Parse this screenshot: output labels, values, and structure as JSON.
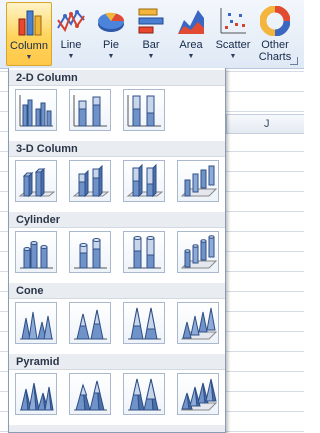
{
  "ribbon": {
    "buttons": [
      {
        "label": "Column",
        "arrow": "▼",
        "icon": "column-chart-icon"
      },
      {
        "label": "Line",
        "arrow": "▼",
        "icon": "line-chart-icon"
      },
      {
        "label": "Pie",
        "arrow": "▼",
        "icon": "pie-chart-icon"
      },
      {
        "label": "Bar",
        "arrow": "▼",
        "icon": "bar-chart-icon"
      },
      {
        "label": "Area",
        "arrow": "▼",
        "icon": "area-chart-icon"
      },
      {
        "label": "Scatter",
        "arrow": "▼",
        "icon": "scatter-chart-icon"
      },
      {
        "label1": "Other",
        "label2": "Charts",
        "arrow": "▼",
        "icon": "doughnut-chart-icon"
      }
    ]
  },
  "sheet": {
    "column_label": "J"
  },
  "gallery": {
    "sections": [
      {
        "title": "2-D Column",
        "items": [
          "Clustered Column",
          "Stacked Column",
          "100% Stacked Column"
        ]
      },
      {
        "title": "3-D Column",
        "items": [
          "3-D Clustered Column",
          "Stacked Column in 3-D",
          "100% Stacked Column in 3-D",
          "3-D Column"
        ]
      },
      {
        "title": "Cylinder",
        "items": [
          "Clustered Cylinder",
          "Stacked Cylinder",
          "100% Stacked Cylinder",
          "3-D Cylinder"
        ]
      },
      {
        "title": "Cone",
        "items": [
          "Clustered Cone",
          "Stacked Cone",
          "100% Stacked Cone",
          "3-D Cone"
        ]
      },
      {
        "title": "Pyramid",
        "items": [
          "Clustered Pyramid",
          "Stacked Pyramid",
          "100% Stacked Pyramid",
          "3-D Pyramid"
        ]
      }
    ]
  },
  "colors": {
    "accent": "#ffd45a",
    "bar_fill": "#6f93c9",
    "bar_stroke": "#2f4f86"
  }
}
